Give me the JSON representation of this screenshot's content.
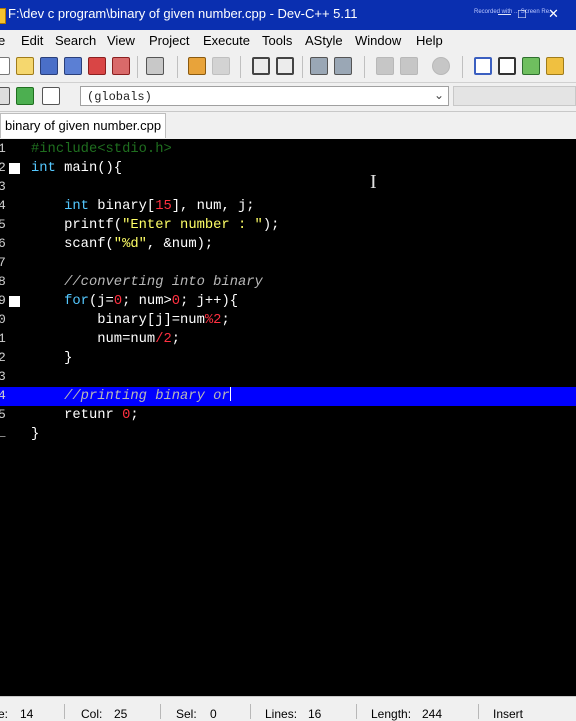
{
  "window": {
    "title": "F:\\dev c program\\binary of given number.cpp - Dev-C++ 5.11",
    "watermark": "Recorded with ... Screen Re..."
  },
  "menu": [
    "e",
    "Edit",
    "Search",
    "View",
    "Project",
    "Execute",
    "Tools",
    "AStyle",
    "Window",
    "Help"
  ],
  "toolbar": {
    "scope": "(globals)"
  },
  "tab": {
    "label": "binary of given number.cpp"
  },
  "editor": {
    "line_numbers": [
      "1",
      "2",
      "3",
      "4",
      "5",
      "6",
      "7",
      "8",
      "9",
      "0",
      "1",
      "2",
      "3",
      "4",
      "5"
    ],
    "lines": [
      {
        "type": "pre",
        "text": "#include<stdio.h>"
      },
      {
        "kw": "int",
        "rest": " main(){"
      },
      {
        "text": ""
      },
      {
        "kw": "    int",
        "a": " binary[",
        "num1": "15",
        "b": "], num, j;"
      },
      {
        "a": "    printf(",
        "str": "\"Enter number : \"",
        "b": ");"
      },
      {
        "a": "    scanf(",
        "str": "\"%d\"",
        "b": ", &num);"
      },
      {
        "text": ""
      },
      {
        "cm": "    //converting into binary"
      },
      {
        "kw": "    for",
        "a": "(j=",
        "n1": "0",
        "b": "; num>",
        "n2": "0",
        "c": "; j++){"
      },
      {
        "a": "        binary[j]=num",
        "op": "%2",
        "b": ";"
      },
      {
        "a": "        num=num",
        "op": "/2",
        "b": ";"
      },
      {
        "a": "    }"
      },
      {
        "text": ""
      },
      {
        "cm": "    //printing binary or"
      },
      {
        "a": "    retunr ",
        "n": "0",
        "b": ";"
      },
      {
        "a": "}"
      }
    ]
  },
  "status": {
    "line_label": "e:",
    "line": "14",
    "col_label": "Col:",
    "col": "25",
    "sel_label": "Sel:",
    "sel": "0",
    "lines_label": "Lines:",
    "lines": "16",
    "length_label": "Length:",
    "length": "244",
    "mode": "Insert"
  }
}
